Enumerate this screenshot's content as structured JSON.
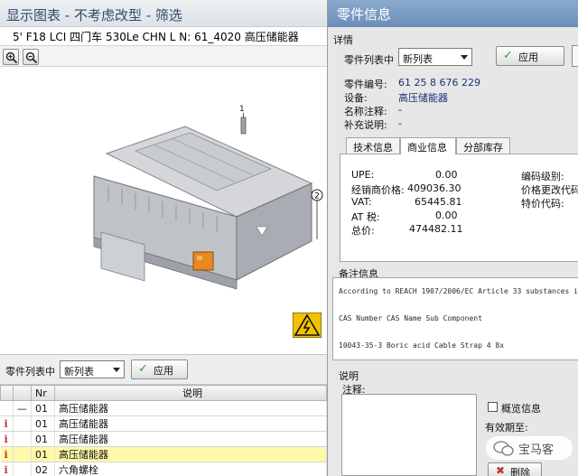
{
  "left_window": {
    "title": "显示图表 - 不考虑改型 - 筛选",
    "subtitle": "5' F18 LCI 四门车 530Le CHN  L N: 61_4020 高压储能器",
    "drawing_callouts": [
      "1",
      "2"
    ],
    "toolbar": {
      "label": "零件列表中",
      "list_value": "新列表",
      "apply_label": "应用"
    },
    "table": {
      "headers": [
        "",
        "",
        "Nr",
        "说明"
      ],
      "rows": [
        {
          "info": "",
          "mark": "—",
          "nr": "01",
          "desc": "高压储能器",
          "selected": false
        },
        {
          "info": "i",
          "mark": "",
          "nr": "01",
          "desc": "高压储能器",
          "selected": false
        },
        {
          "info": "i",
          "mark": "",
          "nr": "01",
          "desc": "高压储能器",
          "selected": false
        },
        {
          "info": "i",
          "mark": "",
          "nr": "01",
          "desc": "高压储能器",
          "selected": true
        },
        {
          "info": "i",
          "mark": "",
          "nr": "02",
          "desc": "六角螺栓",
          "selected": false
        }
      ]
    }
  },
  "right_window": {
    "title": "零件信息",
    "details_section": "详情",
    "list_label": "零件列表中",
    "list_value": "新列表",
    "apply_label": "应用",
    "part_number_label": "零件编号:",
    "part_number": "61 25 8 676 229",
    "device_label": "设备:",
    "device": "高压储能器",
    "name_note_label": "名称注释:",
    "name_note": "-",
    "supplement_label": "补充说明:",
    "supplement": "-",
    "tabs": [
      "技术信息",
      "商业信息",
      "分部库存"
    ],
    "active_tab": 1,
    "commercial": {
      "upe_label": "UPE:",
      "upe": "0.00",
      "dealer_price_label": "经销商价格:",
      "dealer_price": "409036.30",
      "vat_label": "VAT:",
      "vat": "65445.81",
      "at_tax_label": "AT 税:",
      "at_tax": "0.00",
      "total_label": "总价:",
      "total": "474482.11",
      "code_level_label": "编码级别:",
      "price_change_label": "价格更改代码",
      "special_price_label": "特价代码:"
    },
    "notes_section": "备注信息",
    "notes_lines": [
      "According to REACH 1907/2006/EC Article 33 substances i",
      "CAS Number  CAS Name                    Sub Component",
      "10043-35-3  Boric acid                  Cable Strap 4 8x"
    ],
    "remarks_section": "说明",
    "remark_label": "注释:",
    "overview_label": "概览信息",
    "valid_until_label": "有效期至:",
    "delete_label": "删除",
    "watermark": "宝马客"
  }
}
